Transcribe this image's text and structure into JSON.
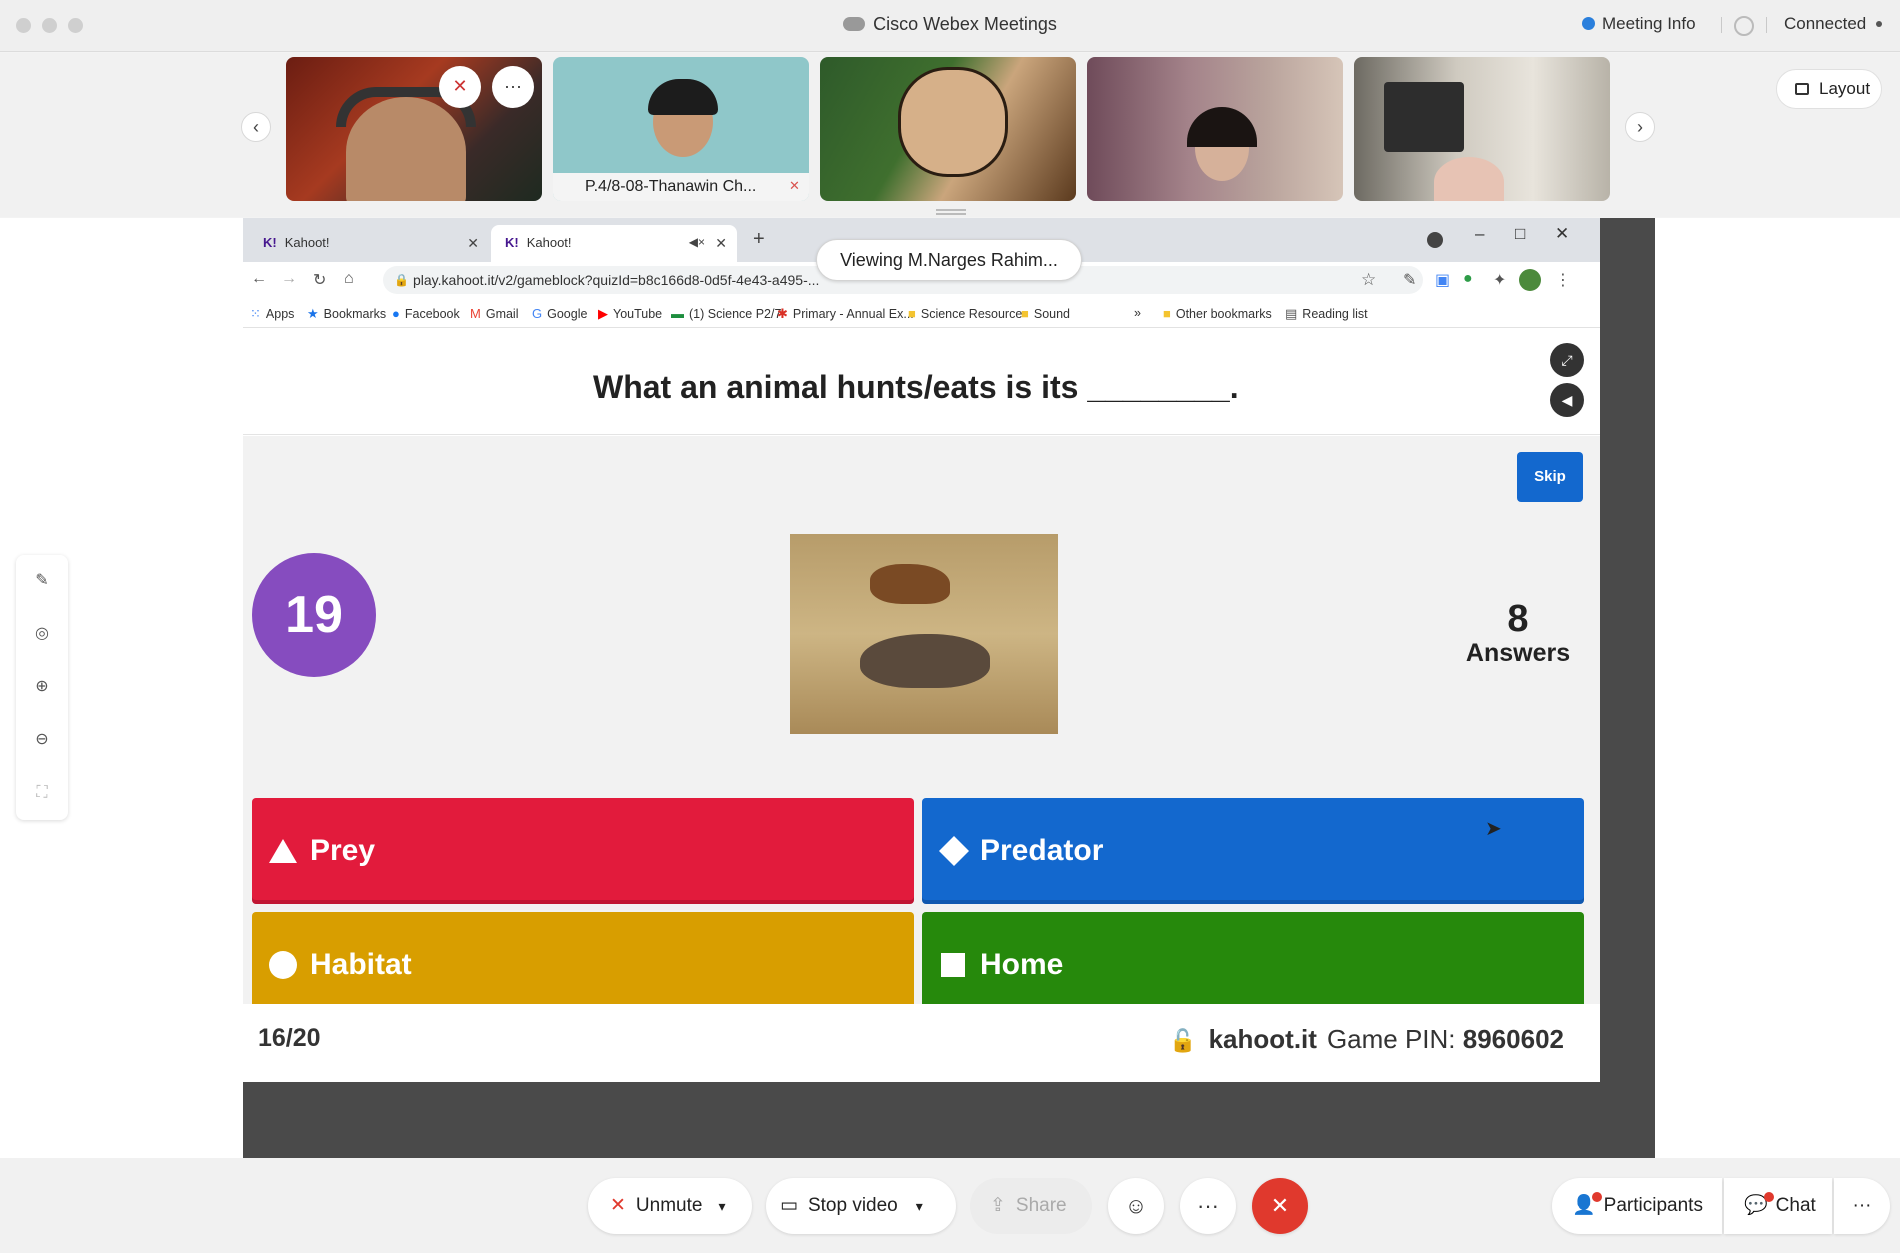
{
  "window": {
    "title": "Cisco Webex Meetings",
    "meeting_info": "Meeting Info",
    "status": "Connected"
  },
  "filmstrip": {
    "participant_label": "P.4/8-08-Thanawin Ch...",
    "layout_label": "Layout"
  },
  "viewing": "Viewing M.Narges Rahim...",
  "browser": {
    "tabs": [
      {
        "label": "Kahoot!"
      },
      {
        "label": "Kahoot!"
      }
    ],
    "url": "play.kahoot.it/v2/gameblock?quizId=b8c166d8-0d5f-4e43-a495-...",
    "bookmarks": [
      "Apps",
      "Bookmarks",
      "Facebook",
      "Gmail",
      "Google",
      "YouTube",
      "(1) Science P2/7",
      "Primary - Annual Ex...",
      "Science Resource",
      "Sound"
    ],
    "other_bookmarks": "Other bookmarks",
    "reading_list": "Reading list"
  },
  "kahoot": {
    "question": "What an animal hunts/eats is its ________.",
    "skip": "Skip",
    "timer": "19",
    "answers_count": "8",
    "answers_label": "Answers",
    "options": [
      {
        "label": "Prey",
        "color": "#e21b3c"
      },
      {
        "label": "Predator",
        "color": "#1368ce"
      },
      {
        "label": "Habitat",
        "color": "#d89e00"
      },
      {
        "label": "Home",
        "color": "#26890c"
      }
    ],
    "progress": "16/20",
    "site": "kahoot.it",
    "pin_label": "Game PIN:",
    "pin": "8960602"
  },
  "controls": {
    "unmute": "Unmute",
    "stop_video": "Stop video",
    "share": "Share",
    "participants": "Participants",
    "chat": "Chat"
  }
}
